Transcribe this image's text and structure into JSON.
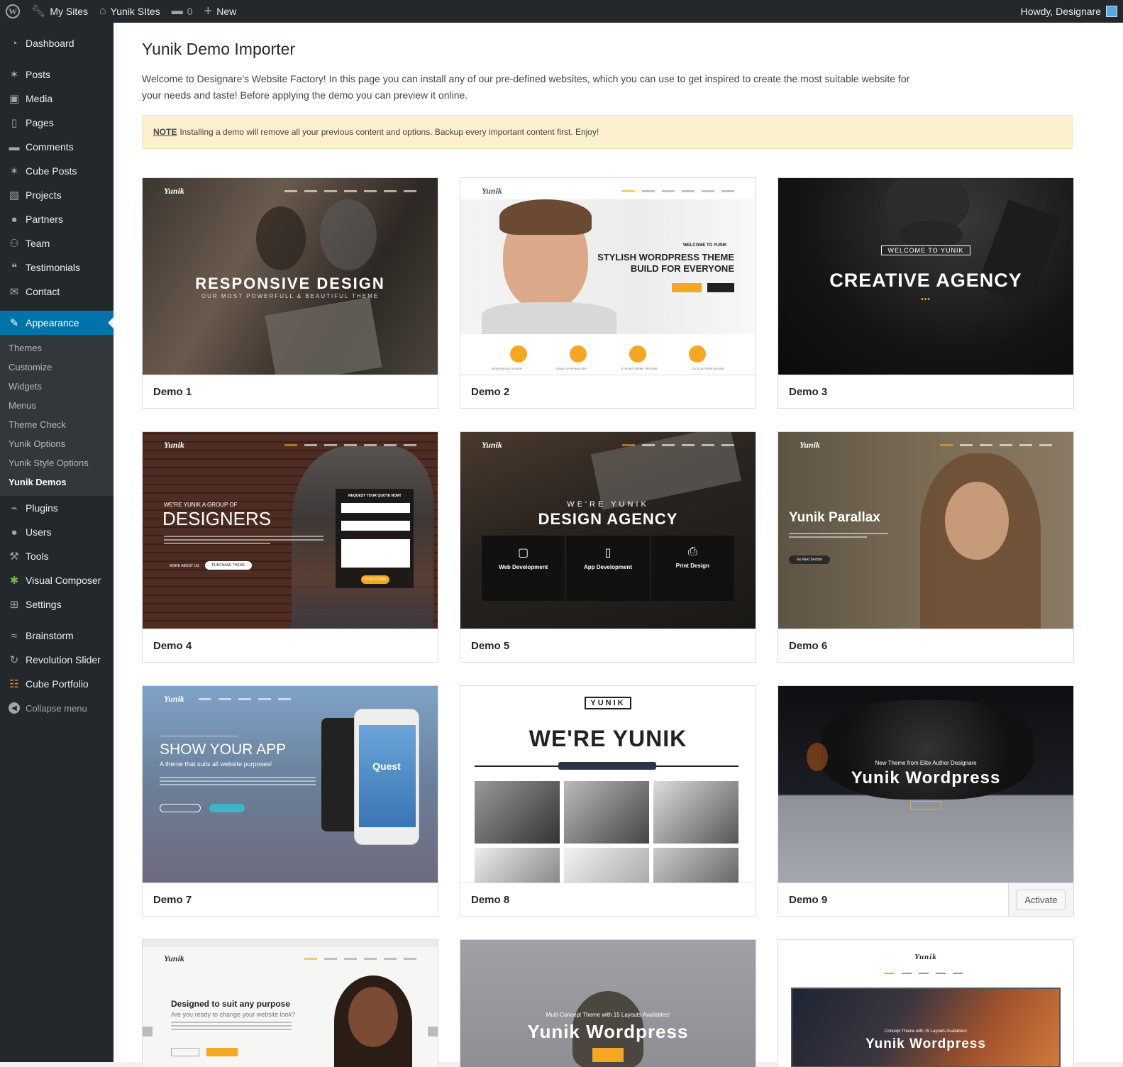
{
  "adminbar": {
    "my_sites": "My Sites",
    "site_name": "Yunik SItes",
    "comments_count": "0",
    "new_label": "New",
    "howdy": "Howdy, Designare"
  },
  "sidebar": {
    "items": [
      {
        "label": "Dashboard",
        "icon": "dashboard-icon"
      },
      {
        "label": "Posts",
        "icon": "pin-icon"
      },
      {
        "label": "Media",
        "icon": "media-icon"
      },
      {
        "label": "Pages",
        "icon": "page-icon"
      },
      {
        "label": "Comments",
        "icon": "comment-icon"
      },
      {
        "label": "Cube Posts",
        "icon": "pin-icon"
      },
      {
        "label": "Projects",
        "icon": "image-icon"
      },
      {
        "label": "Partners",
        "icon": "user-icon"
      },
      {
        "label": "Team",
        "icon": "groups-icon"
      },
      {
        "label": "Testimonials",
        "icon": "quote-icon"
      },
      {
        "label": "Contact",
        "icon": "mail-icon"
      },
      {
        "label": "Appearance",
        "icon": "brush-icon"
      },
      {
        "label": "Plugins",
        "icon": "plugin-icon"
      },
      {
        "label": "Users",
        "icon": "user-icon"
      },
      {
        "label": "Tools",
        "icon": "wrench-icon"
      },
      {
        "label": "Visual Composer",
        "icon": "vc-icon"
      },
      {
        "label": "Settings",
        "icon": "settings-icon"
      },
      {
        "label": "Brainstorm",
        "icon": "brainstorm-icon"
      },
      {
        "label": "Revolution Slider",
        "icon": "refresh-icon"
      },
      {
        "label": "Cube Portfolio",
        "icon": "grid-icon"
      }
    ],
    "submenu": [
      "Themes",
      "Customize",
      "Widgets",
      "Menus",
      "Theme Check",
      "Yunik Options",
      "Yunik Style Options",
      "Yunik Demos"
    ],
    "collapse": "Collapse menu"
  },
  "page": {
    "title": "Yunik Demo Importer",
    "intro": "Welcome to Designare's Website Factory! In this page you can install any of our pre-defined websites, which you can use to get inspired to create the most suitable website for your needs and taste! Before applying the demo you can preview it online.",
    "note_label": "NOTE",
    "note_text": "Installing a demo will remove all your previous content and options. Backup every important content first. Enjoy!"
  },
  "demos": [
    {
      "name": "Demo 1",
      "logo": "Yunik",
      "headline": "RESPONSIVE DESIGN",
      "sub": "OUR MOST POWERFULL & BEAUTIFUL THEME"
    },
    {
      "name": "Demo 2",
      "logo": "Yunik",
      "kicker": "WELCOME TO YUNIK",
      "headline": "STYLISH WORDPRESS THEME BUILD FOR EVERYONE",
      "features": [
        "RESPONSIVE DESIGN",
        "DRAG DROP BUILDER",
        "STRONG THEME OPTIONS",
        "ELITE AUTHOR DESIGN"
      ]
    },
    {
      "name": "Demo 3",
      "kicker": "WELCOME TO YUNIK",
      "headline": "CREATIVE AGENCY"
    },
    {
      "name": "Demo 4",
      "logo": "Yunik",
      "kicker": "WE'RE YUNIK A GROUP OF",
      "headline": "DESIGNERS",
      "form_title": "REQUEST YOUR QUOTE NOW!",
      "btn1": "MORE ABOUT US",
      "btn2": "PURCHASE THEME",
      "btn3": "SEND FORM"
    },
    {
      "name": "Demo 5",
      "logo": "Yunik",
      "kicker": "WE'RE YUNIK",
      "headline": "DESIGN AGENCY",
      "services": [
        "Web Development",
        "App Development",
        "Print Design"
      ]
    },
    {
      "name": "Demo 6",
      "logo": "Yunik",
      "headline": "Yunik Parallax",
      "btn": "Go Next Section"
    },
    {
      "name": "Demo 7",
      "logo": "Yunik",
      "headline": "SHOW YOUR APP",
      "sub": "A theme that suits all website purposes!",
      "app_name": "Quest"
    },
    {
      "name": "Demo 8",
      "logo": "YUNIK",
      "headline": "WE'RE YUNIK"
    },
    {
      "name": "Demo 9",
      "kicker": "New Theme from Elite Author Designare",
      "headline": "Yunik Wordpress",
      "activate": "Activate"
    },
    {
      "name": "",
      "logo": "Yunik",
      "headline": "Designed to suit any purpose",
      "sub": "Are you ready to change your website look?"
    },
    {
      "name": "",
      "kicker": "Multi-Concept Theme with 15 Layouts Availables!",
      "headline": "Yunik Wordpress"
    },
    {
      "name": "",
      "logo": "Yunik",
      "kicker": "Concept Theme with 15 Layouts Availables!",
      "headline": "Yunik Wordpress"
    }
  ],
  "colors": {
    "admin_bg": "#23282d",
    "accent": "#0073aa",
    "notice_bg": "#fcf0cf",
    "orange": "#f5a623"
  }
}
